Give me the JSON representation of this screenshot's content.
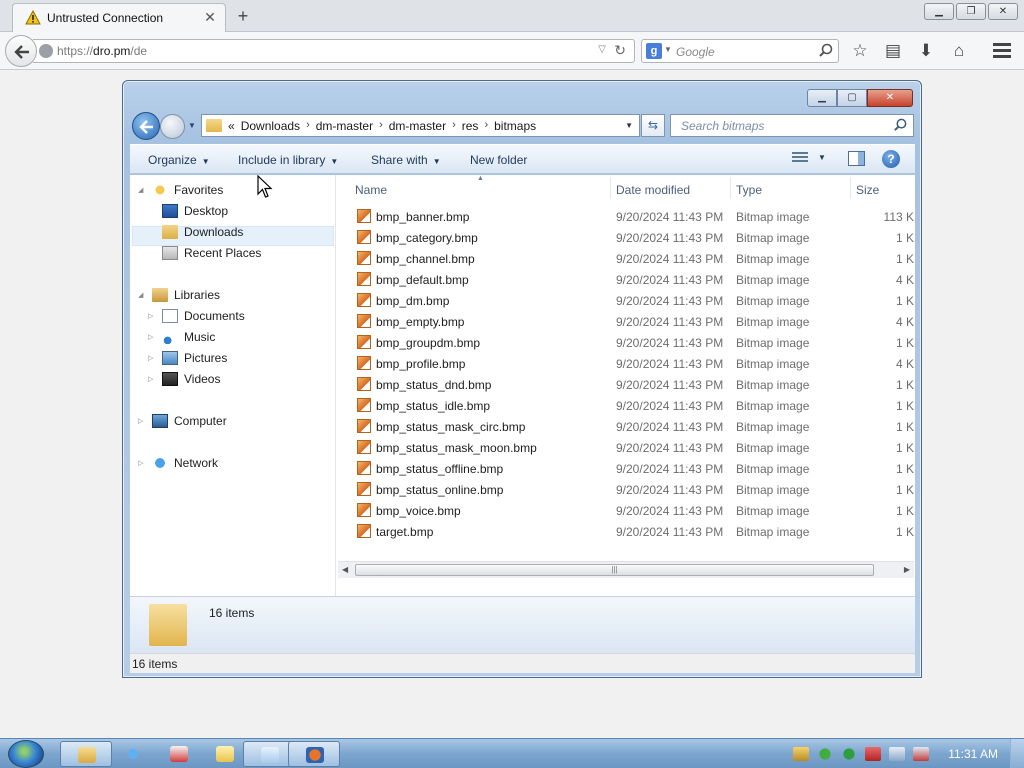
{
  "browser": {
    "tab_title": "Untrusted Connection",
    "url_prefix": "https://",
    "url_host": "dro.pm",
    "url_path": "/de",
    "search_placeholder": "Google",
    "search_engine_letter": "g"
  },
  "explorer": {
    "breadcrumb": [
      "«",
      "Downloads",
      "dm-master",
      "dm-master",
      "res",
      "bitmaps"
    ],
    "search_placeholder": "Search bitmaps",
    "commands": {
      "organize": "Organize",
      "include": "Include in library",
      "share": "Share with",
      "new_folder": "New folder"
    },
    "nav": {
      "favorites": "Favorites",
      "desktop": "Desktop",
      "downloads": "Downloads",
      "recent": "Recent Places",
      "libraries": "Libraries",
      "documents": "Documents",
      "music": "Music",
      "pictures": "Pictures",
      "videos": "Videos",
      "computer": "Computer",
      "network": "Network"
    },
    "columns": {
      "name": "Name",
      "date": "Date modified",
      "type": "Type",
      "size": "Size"
    },
    "files": [
      {
        "name": "bmp_banner.bmp",
        "date": "9/20/2024 11:43 PM",
        "type": "Bitmap image",
        "size": "113 K"
      },
      {
        "name": "bmp_category.bmp",
        "date": "9/20/2024 11:43 PM",
        "type": "Bitmap image",
        "size": "1 K"
      },
      {
        "name": "bmp_channel.bmp",
        "date": "9/20/2024 11:43 PM",
        "type": "Bitmap image",
        "size": "1 K"
      },
      {
        "name": "bmp_default.bmp",
        "date": "9/20/2024 11:43 PM",
        "type": "Bitmap image",
        "size": "4 K"
      },
      {
        "name": "bmp_dm.bmp",
        "date": "9/20/2024 11:43 PM",
        "type": "Bitmap image",
        "size": "1 K"
      },
      {
        "name": "bmp_empty.bmp",
        "date": "9/20/2024 11:43 PM",
        "type": "Bitmap image",
        "size": "4 K"
      },
      {
        "name": "bmp_groupdm.bmp",
        "date": "9/20/2024 11:43 PM",
        "type": "Bitmap image",
        "size": "1 K"
      },
      {
        "name": "bmp_profile.bmp",
        "date": "9/20/2024 11:43 PM",
        "type": "Bitmap image",
        "size": "4 K"
      },
      {
        "name": "bmp_status_dnd.bmp",
        "date": "9/20/2024 11:43 PM",
        "type": "Bitmap image",
        "size": "1 K"
      },
      {
        "name": "bmp_status_idle.bmp",
        "date": "9/20/2024 11:43 PM",
        "type": "Bitmap image",
        "size": "1 K"
      },
      {
        "name": "bmp_status_mask_circ.bmp",
        "date": "9/20/2024 11:43 PM",
        "type": "Bitmap image",
        "size": "1 K"
      },
      {
        "name": "bmp_status_mask_moon.bmp",
        "date": "9/20/2024 11:43 PM",
        "type": "Bitmap image",
        "size": "1 K"
      },
      {
        "name": "bmp_status_offline.bmp",
        "date": "9/20/2024 11:43 PM",
        "type": "Bitmap image",
        "size": "1 K"
      },
      {
        "name": "bmp_status_online.bmp",
        "date": "9/20/2024 11:43 PM",
        "type": "Bitmap image",
        "size": "1 K"
      },
      {
        "name": "bmp_voice.bmp",
        "date": "9/20/2024 11:43 PM",
        "type": "Bitmap image",
        "size": "1 K"
      },
      {
        "name": "target.bmp",
        "date": "9/20/2024 11:43 PM",
        "type": "Bitmap image",
        "size": "1 K"
      }
    ],
    "details_count": "16 items",
    "status_count": "16 items"
  },
  "taskbar": {
    "clock": "11:31 AM"
  },
  "colors": {
    "firefox_tabbar": "#dfe3e8",
    "explorer_frame": "#b9d1ea",
    "selection": "#e5f0fb",
    "taskbar": "#7da6cf"
  }
}
